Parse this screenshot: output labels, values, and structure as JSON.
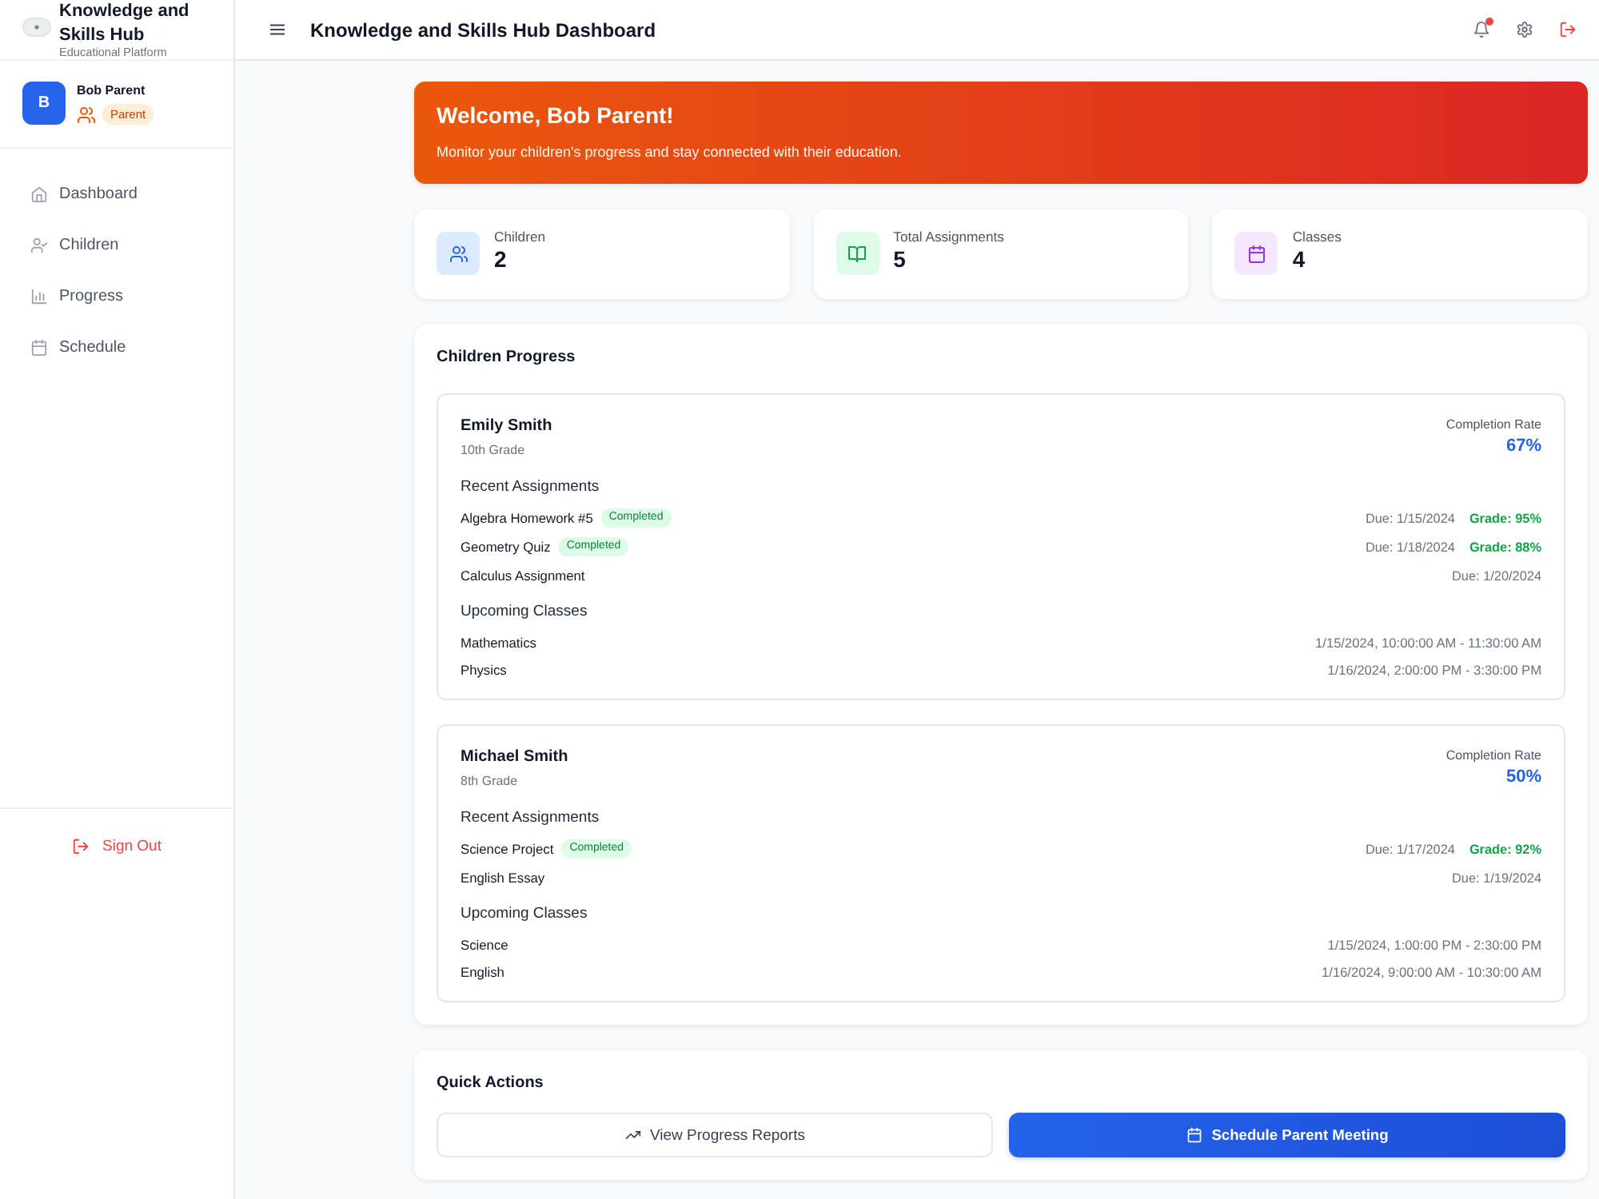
{
  "sidebar": {
    "brand": {
      "title": "Knowledge and Skills Hub",
      "subtitle": "Educational Platform"
    },
    "user": {
      "initial": "B",
      "name": "Bob Parent",
      "role": "Parent"
    },
    "nav": [
      {
        "label": "Dashboard",
        "selected": false
      },
      {
        "label": "Children",
        "selected": false
      },
      {
        "label": "Progress",
        "selected": false
      },
      {
        "label": "Schedule",
        "selected": false
      }
    ],
    "sign_out": "Sign Out"
  },
  "header": {
    "title": "Knowledge and Skills Hub Dashboard",
    "notifications": {
      "unread": true
    }
  },
  "welcome": {
    "title": "Welcome, Bob Parent!",
    "message": "Monitor your children's progress and stay connected with their education."
  },
  "stats": [
    {
      "label": "Children",
      "value": "2"
    },
    {
      "label": "Total Assignments",
      "value": "5"
    },
    {
      "label": "Classes",
      "value": "4"
    }
  ],
  "children_progress": {
    "title": "Children Progress",
    "students": [
      {
        "name": "Emily Smith",
        "grade_level": "10th Grade",
        "completion_label": "Completion Rate",
        "completion_rate": "67%",
        "assignments_heading": "Recent Assignments",
        "assignments": [
          {
            "title": "Algebra Homework #5",
            "status": "Completed",
            "due": "Due: 1/15/2024",
            "grade": "Grade: 95%"
          },
          {
            "title": "Geometry Quiz",
            "status": "Completed",
            "due": "Due: 1/18/2024",
            "grade": "Grade: 88%"
          },
          {
            "title": "Calculus Assignment",
            "due": "Due: 1/20/2024"
          }
        ],
        "classes_heading": "Upcoming Classes",
        "classes": [
          {
            "subject": "Mathematics",
            "time": "1/15/2024, 10:00:00 AM - 11:30:00 AM"
          },
          {
            "subject": "Physics",
            "time": "1/16/2024, 2:00:00 PM - 3:30:00 PM"
          }
        ]
      },
      {
        "name": "Michael Smith",
        "grade_level": "8th Grade",
        "completion_label": "Completion Rate",
        "completion_rate": "50%",
        "assignments_heading": "Recent Assignments",
        "assignments": [
          {
            "title": "Science Project",
            "status": "Completed",
            "due": "Due: 1/17/2024",
            "grade": "Grade: 92%"
          },
          {
            "title": "English Essay",
            "due": "Due: 1/19/2024"
          }
        ],
        "classes_heading": "Upcoming Classes",
        "classes": [
          {
            "subject": "Science",
            "time": "1/15/2024, 1:00:00 PM - 2:30:00 PM"
          },
          {
            "subject": "English",
            "time": "1/16/2024, 9:00:00 AM - 10:30:00 AM"
          }
        ]
      }
    ]
  },
  "quick_actions": {
    "title": "Quick Actions",
    "buttons": [
      {
        "label": "View Progress Reports",
        "kind": "outline"
      },
      {
        "label": "Schedule Parent Meeting",
        "kind": "primary"
      }
    ]
  }
}
